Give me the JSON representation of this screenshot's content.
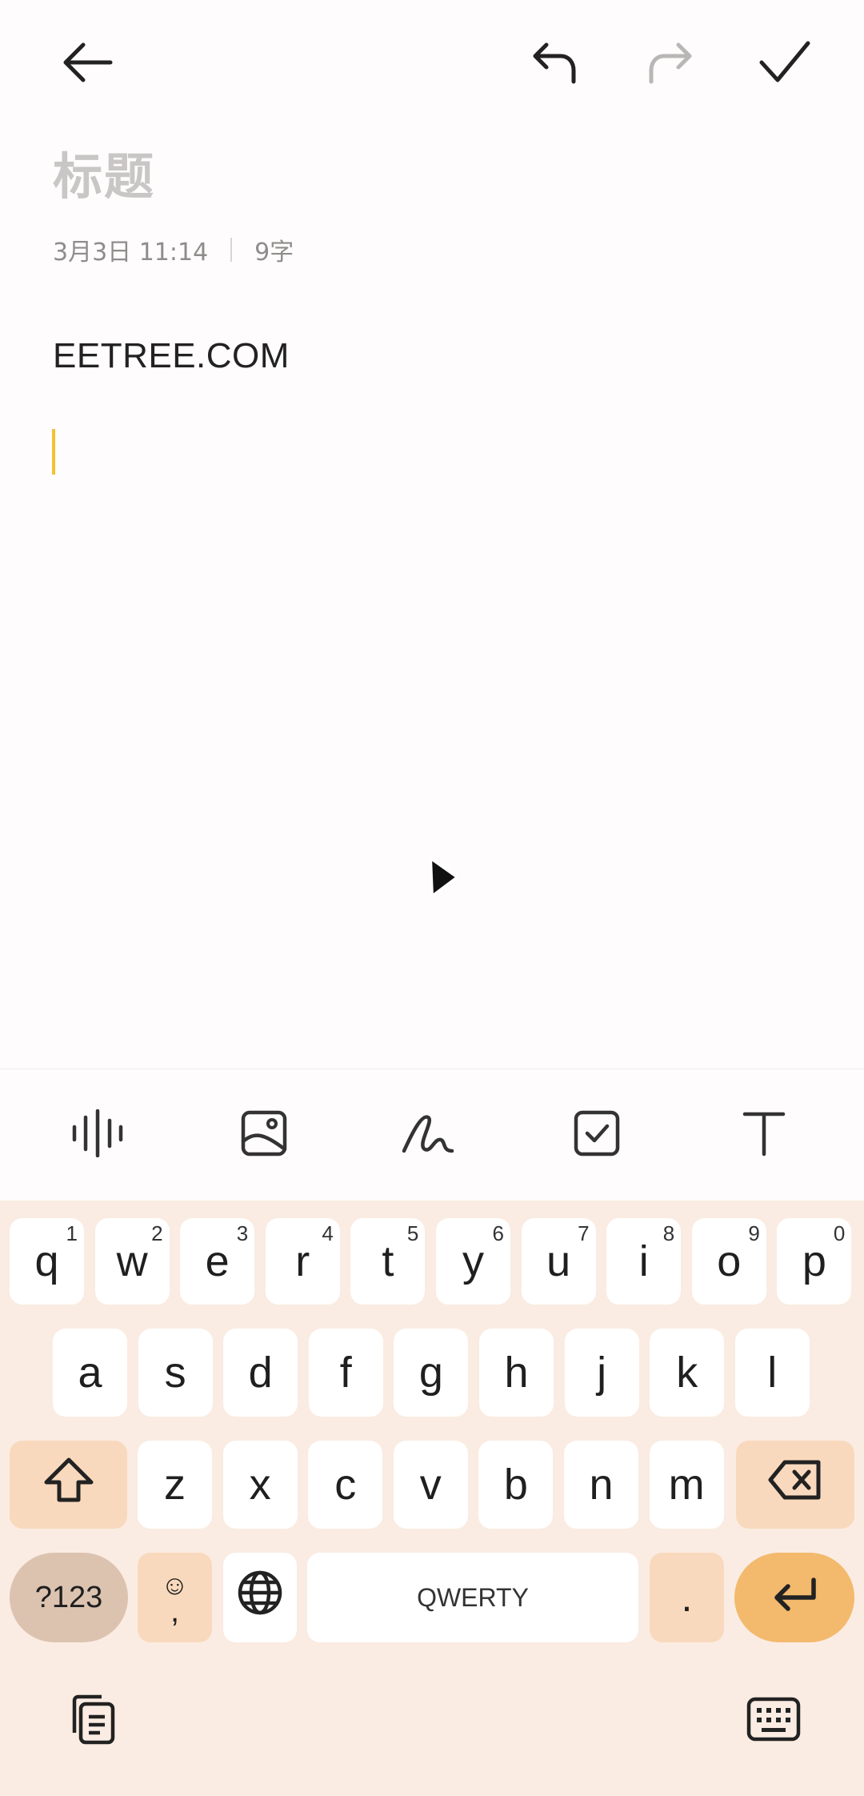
{
  "note": {
    "title_placeholder": "标题",
    "date": "3月3日 11:14",
    "char_count": "9字",
    "body": "EETREE.COM"
  },
  "header_icons": [
    "back-arrow-icon",
    "undo-icon",
    "redo-icon",
    "check-icon"
  ],
  "toolbar_icons": [
    "voice-waveform-icon",
    "image-icon",
    "handwriting-icon",
    "checklist-icon",
    "text-format-icon"
  ],
  "keyboard": {
    "row1": [
      {
        "k": "q",
        "n": "1"
      },
      {
        "k": "w",
        "n": "2"
      },
      {
        "k": "e",
        "n": "3"
      },
      {
        "k": "r",
        "n": "4"
      },
      {
        "k": "t",
        "n": "5"
      },
      {
        "k": "y",
        "n": "6"
      },
      {
        "k": "u",
        "n": "7"
      },
      {
        "k": "i",
        "n": "8"
      },
      {
        "k": "o",
        "n": "9"
      },
      {
        "k": "p",
        "n": "0"
      }
    ],
    "row2": [
      "a",
      "s",
      "d",
      "f",
      "g",
      "h",
      "j",
      "k",
      "l"
    ],
    "row3": [
      "z",
      "x",
      "c",
      "v",
      "b",
      "n",
      "m"
    ],
    "symbols_label": "?123",
    "emoji_glyph": "☺",
    "comma": ",",
    "space_label": "QWERTY",
    "period": ".",
    "colors": {
      "background": "#faece2",
      "key": "#ffffff",
      "function_key": "#f9d9bd",
      "enter": "#f3b96c",
      "symbols": "#dcc3b0"
    }
  },
  "colors": {
    "caret": "#f1c232",
    "title_placeholder": "#c9c6c6"
  }
}
